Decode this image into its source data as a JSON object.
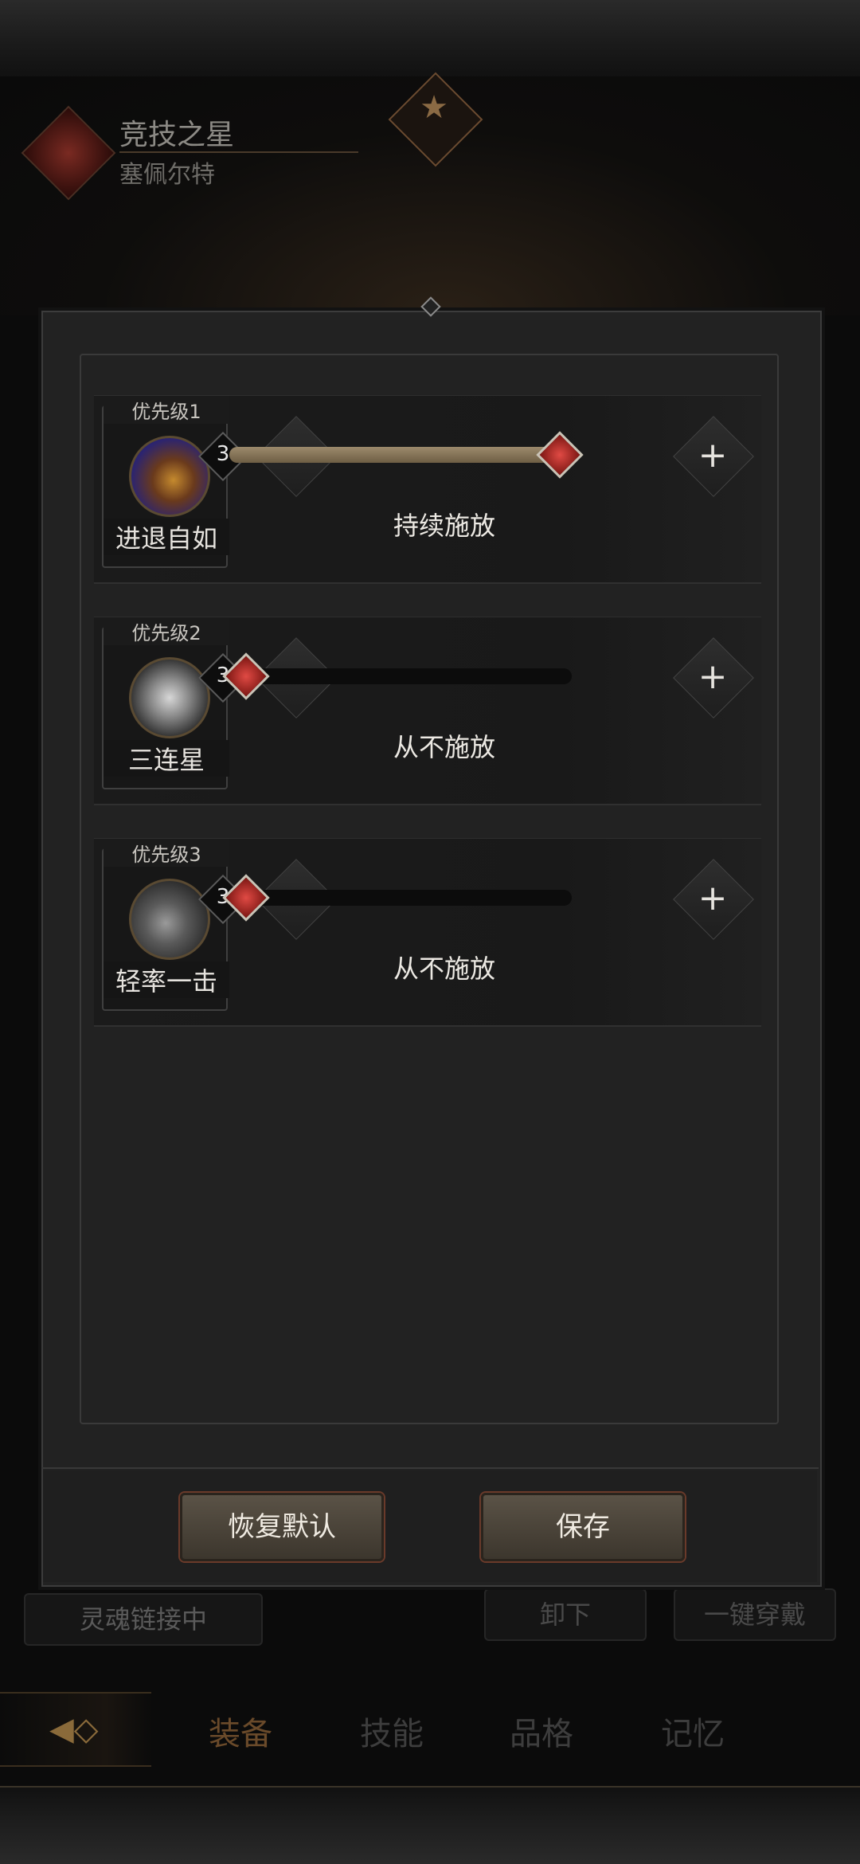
{
  "header": {
    "title": "竞技之星",
    "subtitle": "塞佩尔特"
  },
  "dialog": {
    "skills": [
      {
        "priority_label": "优先级1",
        "name": "进退自如",
        "level": "3",
        "mode": "持续施放",
        "slider_value": 1.0
      },
      {
        "priority_label": "优先级2",
        "name": "三连星",
        "level": "3",
        "mode": "从不施放",
        "slider_value": 0.0
      },
      {
        "priority_label": "优先级3",
        "name": "轻率一击",
        "level": "3",
        "mode": "从不施放",
        "slider_value": 0.0
      }
    ],
    "stepper": {
      "minus": "−",
      "plus": "+"
    },
    "buttons": {
      "reset": "恢复默认",
      "save": "保存"
    }
  },
  "background": {
    "soul_link": "灵魂链接中",
    "unequip": "卸下",
    "equip_all": "一键穿戴",
    "tabs": [
      "装备",
      "技能",
      "品格",
      "记忆"
    ],
    "active_tab": "装备"
  },
  "colors": {
    "accent": "#6a4a2a",
    "thumb": "#e04a44",
    "panel": "#222222"
  }
}
